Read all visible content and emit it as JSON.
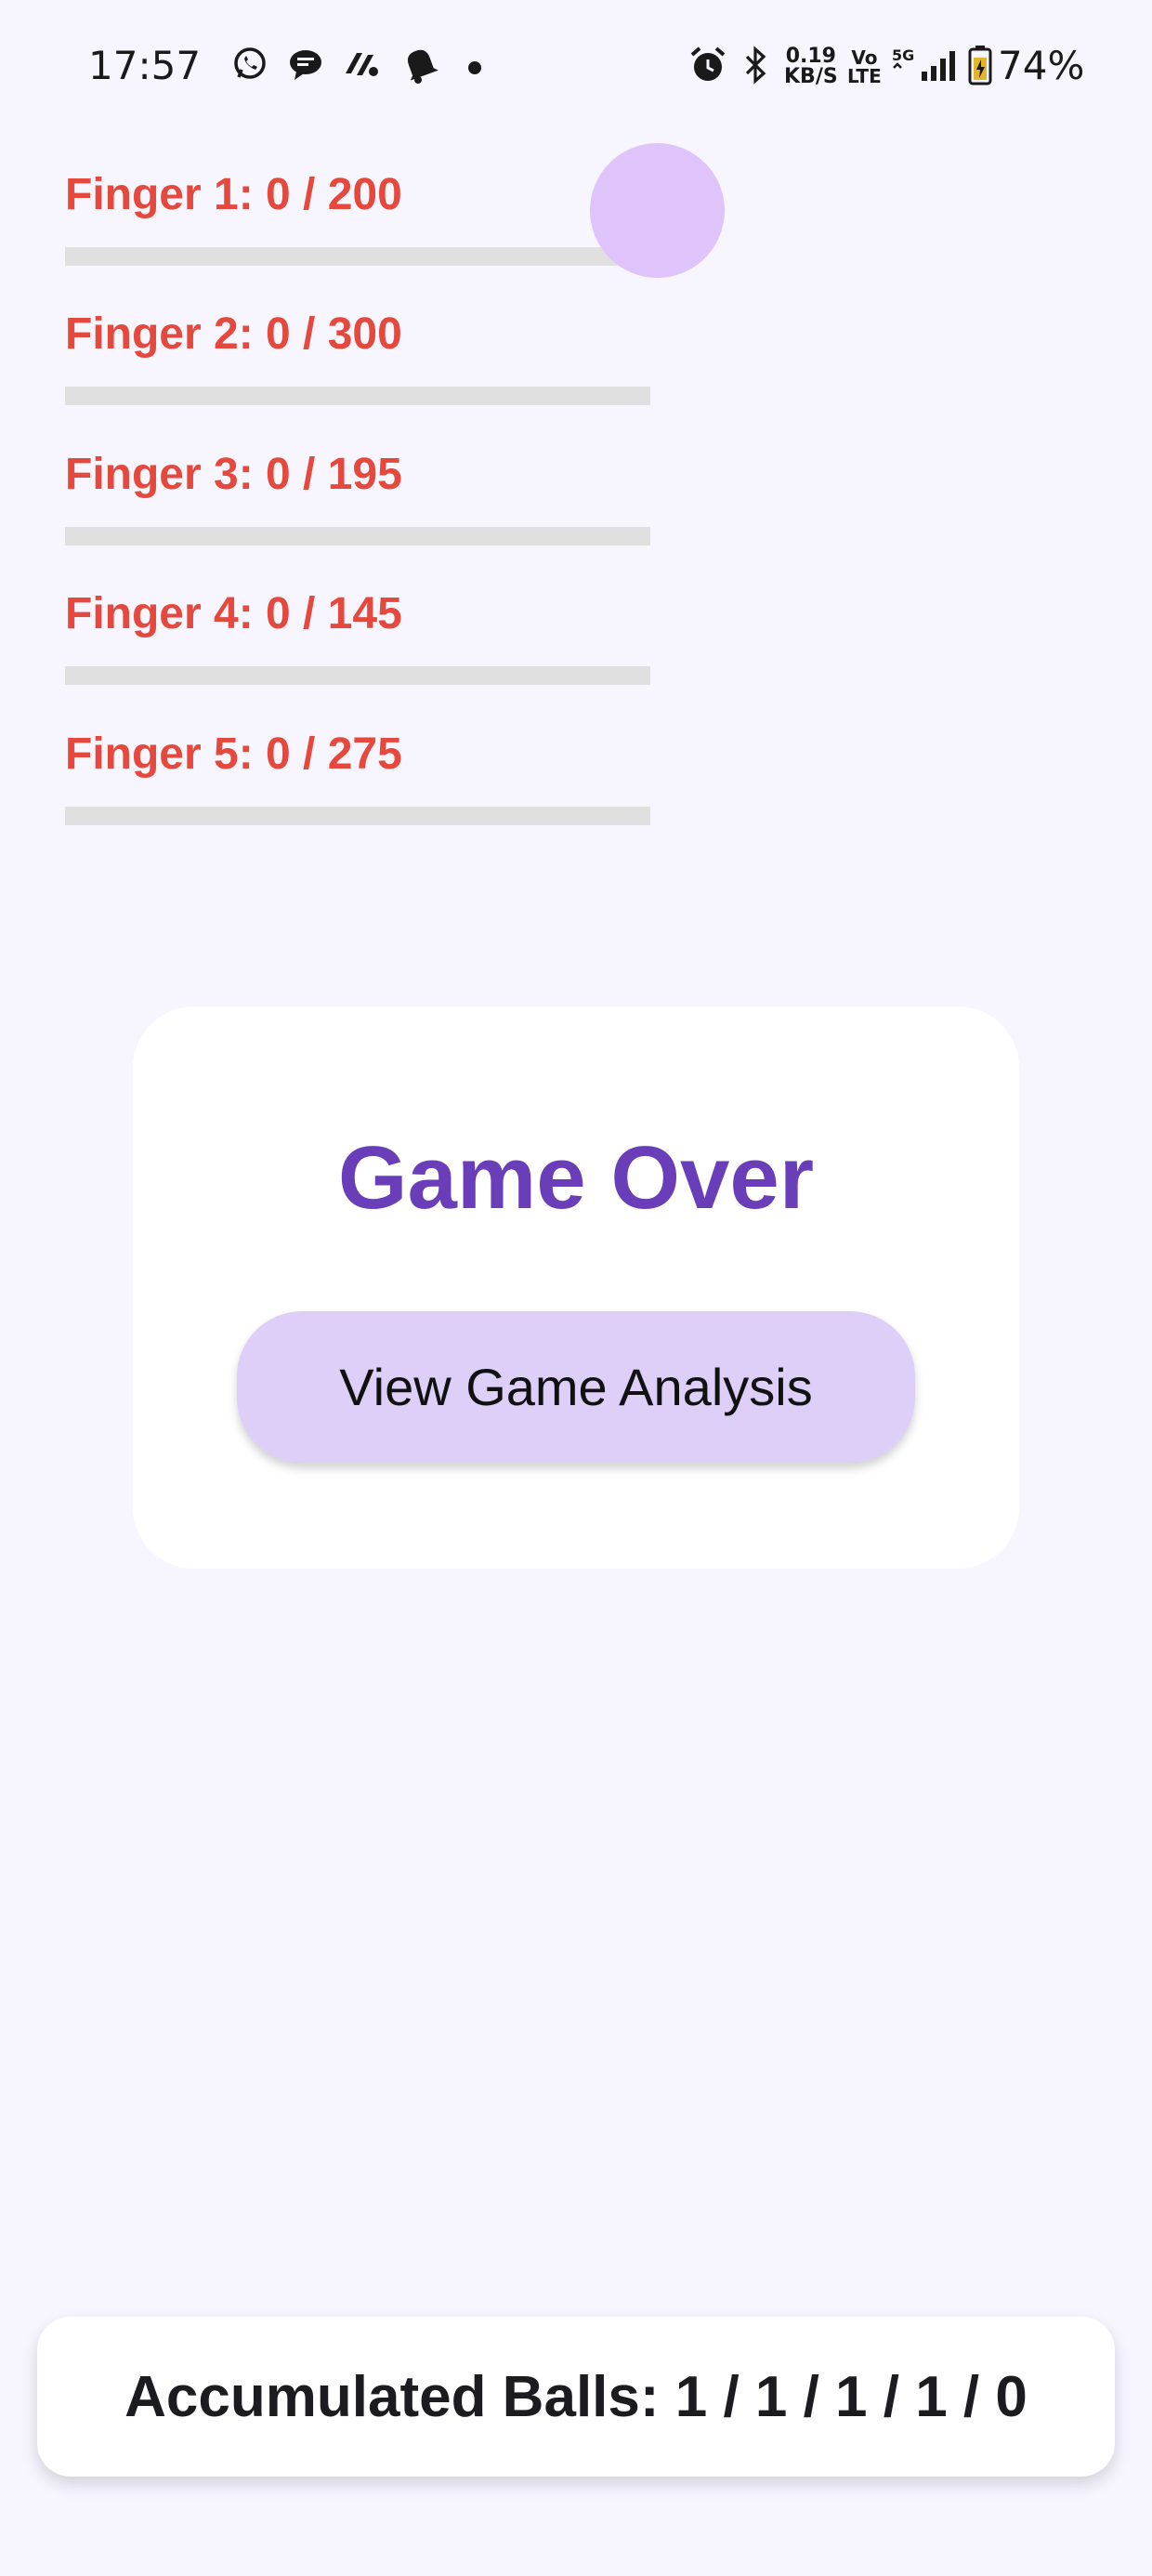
{
  "status_bar": {
    "time": "17:57",
    "network_speed_value": "0.19",
    "network_speed_unit": "KB/S",
    "volte_top": "Vo",
    "volte_bottom": "LTE",
    "network_type": "5G",
    "battery_percent": "74%",
    "notification_icons": [
      "whatsapp-icon",
      "chat-bubble-icon",
      "app-logo-icon",
      "bell-icon",
      "more-dot-icon"
    ],
    "system_icons": [
      "alarm-icon",
      "bluetooth-icon",
      "signal-icon",
      "battery-charging-icon"
    ]
  },
  "fingers": [
    {
      "label": "Finger 1: 0 / 200",
      "progress": 0
    },
    {
      "label": "Finger 2: 0 / 300",
      "progress": 0
    },
    {
      "label": "Finger 3: 0 / 195",
      "progress": 0
    },
    {
      "label": "Finger 4: 0 / 145",
      "progress": 0
    },
    {
      "label": "Finger 5: 0 / 275",
      "progress": 0
    }
  ],
  "colors": {
    "background": "#f7f5fe",
    "finger_label": "#e5483d",
    "track": "#e0e0e0",
    "bubble": "#dfc3fb",
    "title": "#6a3eb8",
    "button_bg": "#ddcff8"
  },
  "game_over": {
    "title": "Game Over",
    "button_label": "View Game Analysis"
  },
  "footer": {
    "accumulated_label": "Accumulated Balls: 1 / 1 / 1 / 1 / 0"
  }
}
